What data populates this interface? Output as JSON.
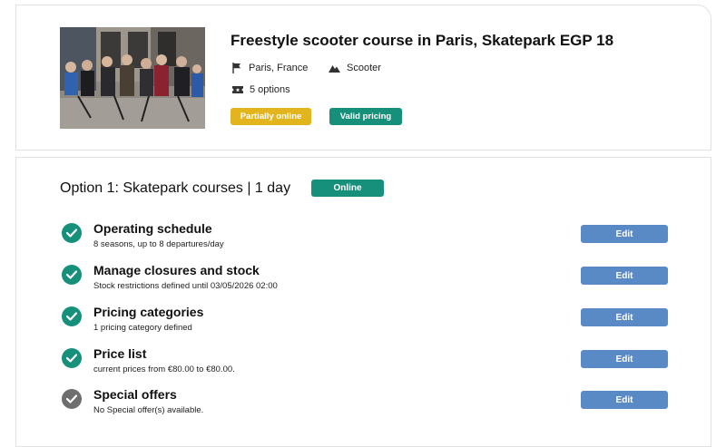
{
  "activity": {
    "title": "Freestyle scooter course in Paris, Skatepark EGP 18",
    "location": "Paris, France",
    "category": "Scooter",
    "options_count": "5 options",
    "badges": {
      "partially_online": "Partially online",
      "valid_pricing": "Valid pricing"
    },
    "photo_icon": "group-photo"
  },
  "option": {
    "title": "Option 1: Skatepark courses | 1 day",
    "status": "Online",
    "rows": [
      {
        "title": "Operating schedule",
        "subtitle": "8 seasons, up to 8 departures/day",
        "status": "complete",
        "edit": "Edit"
      },
      {
        "title": "Manage closures and stock",
        "subtitle": "Stock restrictions defined until 03/05/2026 02:00",
        "status": "complete",
        "edit": "Edit"
      },
      {
        "title": "Pricing categories",
        "subtitle": "1 pricing category defined",
        "status": "complete",
        "edit": "Edit"
      },
      {
        "title": "Price list",
        "subtitle": "current prices from €80.00 to €80.00.",
        "status": "complete",
        "edit": "Edit"
      },
      {
        "title": "Special offers",
        "subtitle": "No Special offer(s) available.",
        "status": "neutral",
        "edit": "Edit"
      }
    ]
  },
  "colors": {
    "complete": "#17907b",
    "neutral": "#6e6e6e",
    "edit_button": "#5a8ac6",
    "badge_yellow": "#e2b51f",
    "badge_green": "#17907b"
  }
}
